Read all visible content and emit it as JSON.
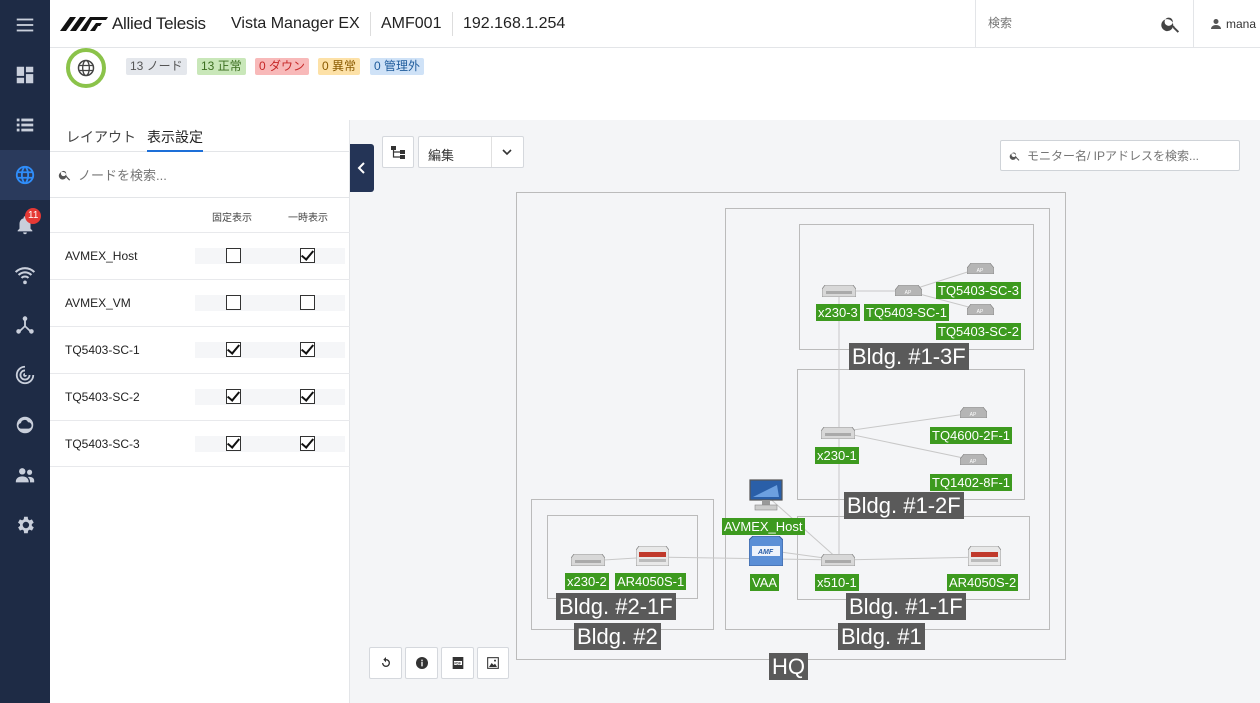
{
  "header": {
    "brand": "Allied Telesis",
    "product": "Vista Manager EX",
    "area": "AMF001",
    "ip": "192.168.1.254",
    "search_placeholder": "検索",
    "user": "mana"
  },
  "rail": {
    "notifications_count": "11",
    "items": [
      "menu-icon",
      "dashboard-icon",
      "list-icon",
      "globe-icon",
      "bell-icon",
      "wifi-icon",
      "topology-icon",
      "radar-icon",
      "cloud-icon",
      "users-icon",
      "gear-icon"
    ],
    "accent": "#2f8dfa"
  },
  "summary": {
    "nodes": "13 ノード",
    "normal": "13 正常",
    "down": "0 ダウン",
    "abnormal": "0 異常",
    "unmanaged": "0 管理外"
  },
  "panel": {
    "tab_layout": "レイアウト",
    "tab_display": "表示設定",
    "search_placeholder": "ノードを検索...",
    "col_fixed": "固定表示",
    "col_temp": "一時表示",
    "rows": [
      {
        "name": "AVMEX_Host",
        "fixed": false,
        "temp": true
      },
      {
        "name": "AVMEX_VM",
        "fixed": false,
        "temp": false
      },
      {
        "name": "TQ5403-SC-1",
        "fixed": true,
        "temp": true
      },
      {
        "name": "TQ5403-SC-2",
        "fixed": true,
        "temp": true
      },
      {
        "name": "TQ5403-SC-3",
        "fixed": true,
        "temp": true
      }
    ]
  },
  "toolbar": {
    "edit_label": "編集",
    "monitor_search_placeholder": "モニター名/ IPアドレスを検索..."
  },
  "map": {
    "groups": {
      "hq": "HQ",
      "bldg1": "Bldg. #1",
      "bldg1_1f": "Bldg. #1-1F",
      "bldg1_2f": "Bldg. #1-2F",
      "bldg1_3f": "Bldg. #1-3F",
      "bldg2": "Bldg. #2",
      "bldg2_1f": "Bldg. #2-1F"
    },
    "nodes": {
      "x230_3": "x230-3",
      "tq5403_sc_1": "TQ5403-SC-1",
      "tq5403_sc_2": "TQ5403-SC-2",
      "tq5403_sc_3": "TQ5403-SC-3",
      "x230_1": "x230-1",
      "tq4600_2f_1": "TQ4600-2F-1",
      "tq1402_8f_1": "TQ1402-8F-1",
      "avmex_host": "AVMEX_Host",
      "vaa": "VAA",
      "x510_1": "x510-1",
      "ar4050s_2": "AR4050S-2",
      "x230_2": "x230-2",
      "ar4050s_1": "AR4050S-1"
    },
    "ap_tag": "AP",
    "vaa_tag": "AMF",
    "label_color": "#3d9a1f",
    "group_label_color": "#5a5a5a"
  }
}
